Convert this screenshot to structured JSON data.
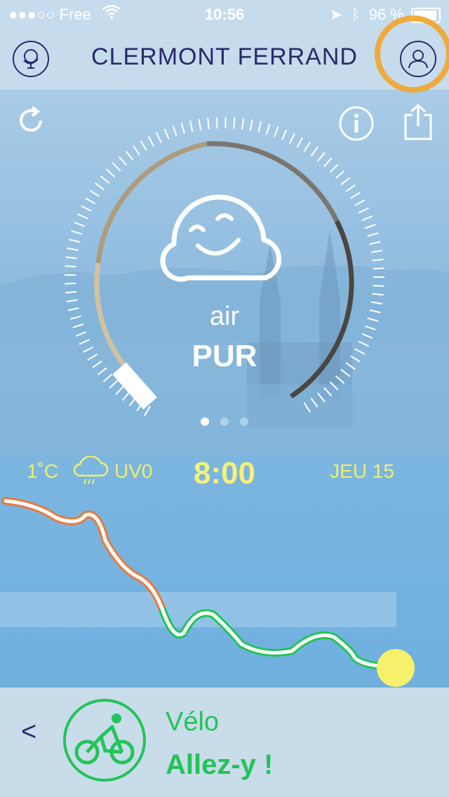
{
  "status_bar": {
    "carrier": "●●●○○ Free",
    "time": "10:56",
    "battery": "96 %"
  },
  "header": {
    "title": "CLERMONT FERRAND"
  },
  "air_quality": {
    "label": "air",
    "status": "PUR"
  },
  "pager": {
    "pages": 3,
    "active": 0
  },
  "weather": {
    "temperature": "1˚C",
    "uv": "UV0",
    "time": "8:00",
    "day": "JEU 15"
  },
  "activity": {
    "back_label": "<",
    "name": "Vélo",
    "message": "Allez-y !"
  },
  "colors": {
    "accent": "#f0a833",
    "text_dark": "#2a2a6a",
    "weather": "#f2ee6a",
    "good": "#22c458"
  }
}
